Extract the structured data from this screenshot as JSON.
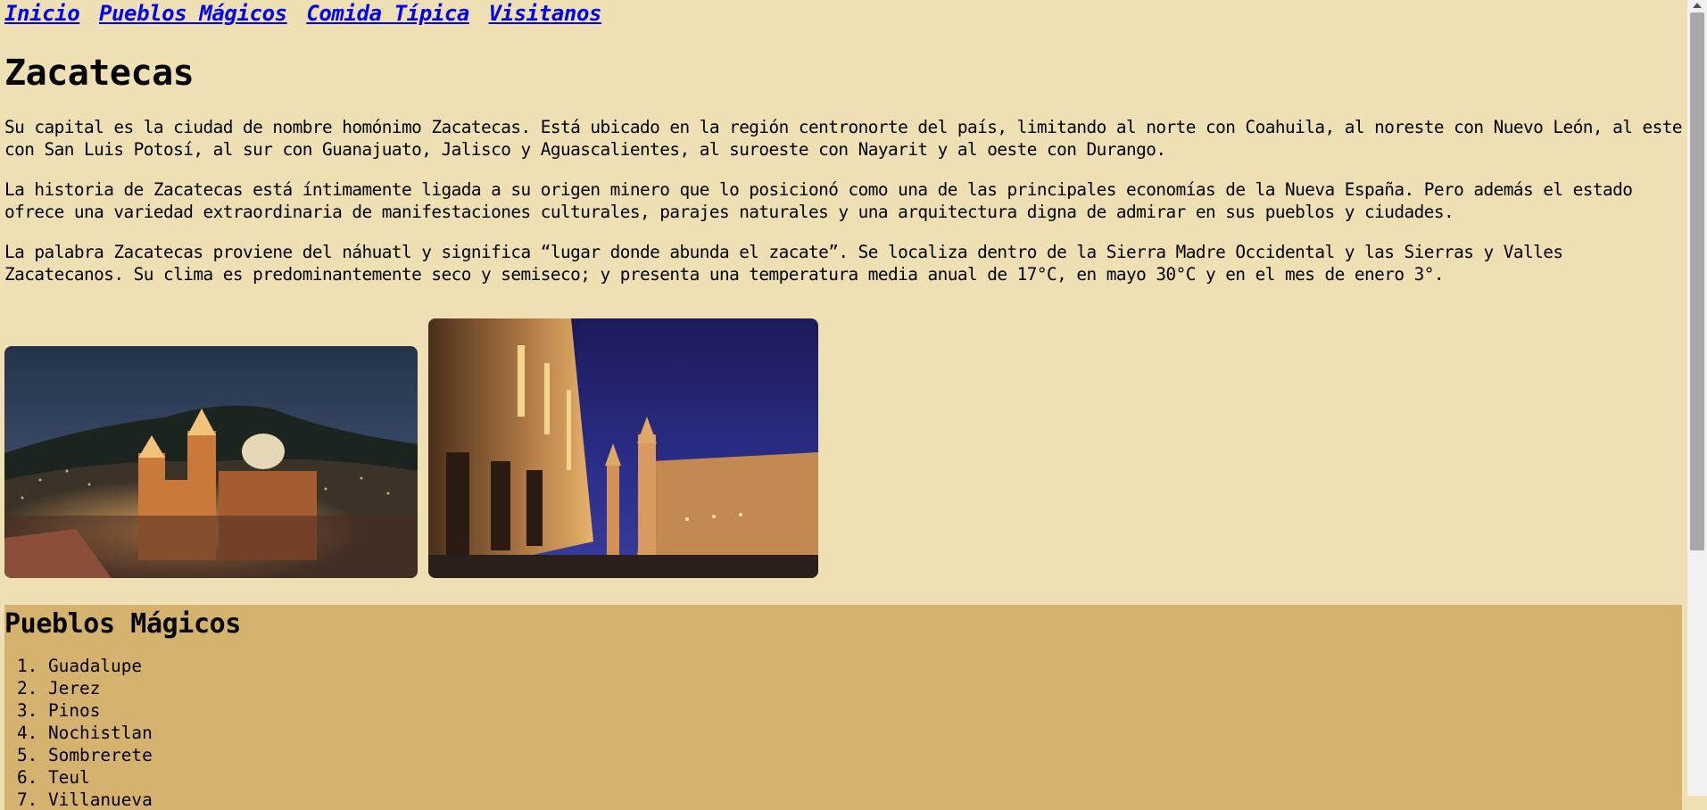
{
  "nav": {
    "links": [
      "Inicio",
      "Pueblos Mágicos",
      "Comida Típica",
      "Visitanos"
    ]
  },
  "main": {
    "title": "Zacatecas",
    "paragraphs": [
      "Su capital es la ciudad de nombre homónimo Zacatecas. Está ubicado en la región centronorte del país, limitando al norte con Coahuila, al noreste con Nuevo León, al este con San Luis Potosí, al sur con Guanajuato, Jalisco y Aguascalientes, al suroeste con Nayarit y al oeste con Durango.",
      "La historia de Zacatecas está íntimamente ligada a su origen minero que lo posicionó como una de las principales economías de la Nueva España. Pero además el estado ofrece una variedad extraordinaria de manifestaciones culturales, parajes naturales y una arquitectura digna de admirar en sus pueblos y ciudades.",
      "La palabra Zacatecas proviene del náhuatl y significa “lugar donde abunda el zacate”. Se localiza dentro de la Sierra Madre Occidental y las Sierras y Valles Zacatecanos. Su clima es predominantemente seco y semiseco; y presenta una temperatura media anual de 17°C, en mayo 30°C y en el mes de enero 3°."
    ]
  },
  "pueblos": {
    "title": "Pueblos Mágicos",
    "items": [
      "Guadalupe",
      "Jerez",
      "Pinos",
      "Nochistlan",
      "Sombrerete",
      "Teul",
      "Villanueva"
    ]
  },
  "colors": {
    "background": "#EEE0B3",
    "section_background": "#D6B26F",
    "link": "#0000EE"
  }
}
